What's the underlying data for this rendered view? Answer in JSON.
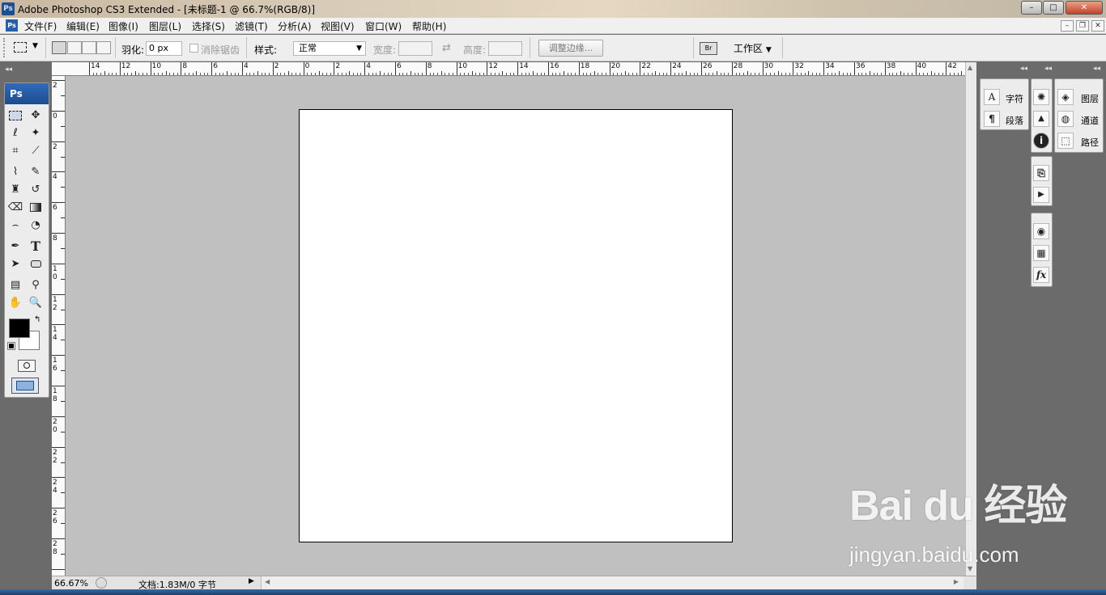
{
  "window": {
    "app_icon": "Ps",
    "title": "Adobe Photoshop CS3 Extended - [未标题-1 @ 66.7%(RGB/8)]",
    "minimize": "–",
    "maximize": "□",
    "close": "✕"
  },
  "menu": {
    "items": [
      "文件(F)",
      "编辑(E)",
      "图像(I)",
      "图层(L)",
      "选择(S)",
      "滤镜(T)",
      "分析(A)",
      "视图(V)",
      "窗口(W)",
      "帮助(H)"
    ],
    "doc_minimize": "–",
    "doc_restore": "❐",
    "doc_close": "✕"
  },
  "options": {
    "feather_label": "羽化:",
    "feather_value": "0 px",
    "antialias_label": "消除锯齿",
    "style_label": "样式:",
    "style_value": "正常",
    "width_label": "宽度:",
    "height_label": "高度:",
    "refine_edge": "调整边缘...",
    "workspace": "工作区"
  },
  "ruler": {
    "h_ticks": [
      "14",
      "12",
      "10",
      "8",
      "6",
      "4",
      "2",
      "0",
      "2",
      "4",
      "6",
      "8",
      "10",
      "12",
      "14",
      "16",
      "18",
      "20",
      "22",
      "24",
      "26",
      "28",
      "30",
      "32",
      "34",
      "36",
      "38",
      "40",
      "42"
    ],
    "v_ticks": [
      "2",
      "0",
      "2",
      "4",
      "6",
      "8",
      "10",
      "12",
      "14",
      "16",
      "18",
      "20",
      "22",
      "24",
      "26",
      "28",
      "30"
    ]
  },
  "toolbox": {
    "logo": "Ps"
  },
  "statusbar": {
    "zoom": "66.67%",
    "doc_info": "文档:1.83M/0 字节"
  },
  "panels": {
    "character": "字符",
    "paragraph": "段落",
    "layers": "图层",
    "channels": "通道",
    "paths": "路径"
  },
  "watermark": {
    "brand": "Bai du 经验",
    "url": "jingyan.baidu.com"
  },
  "colors": {
    "foreground": "#000000",
    "background": "#ffffff",
    "canvas_bg": "#c0c0c0",
    "workspace_bg": "#6b6b6b"
  }
}
